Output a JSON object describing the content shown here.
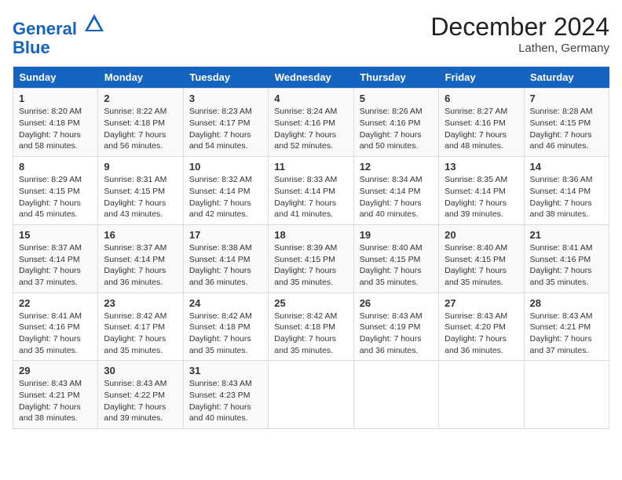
{
  "header": {
    "logo_line1": "General",
    "logo_line2": "Blue",
    "month": "December 2024",
    "location": "Lathen, Germany"
  },
  "weekdays": [
    "Sunday",
    "Monday",
    "Tuesday",
    "Wednesday",
    "Thursday",
    "Friday",
    "Saturday"
  ],
  "weeks": [
    [
      {
        "day": "1",
        "info": "Sunrise: 8:20 AM\nSunset: 4:18 PM\nDaylight: 7 hours\nand 58 minutes."
      },
      {
        "day": "2",
        "info": "Sunrise: 8:22 AM\nSunset: 4:18 PM\nDaylight: 7 hours\nand 56 minutes."
      },
      {
        "day": "3",
        "info": "Sunrise: 8:23 AM\nSunset: 4:17 PM\nDaylight: 7 hours\nand 54 minutes."
      },
      {
        "day": "4",
        "info": "Sunrise: 8:24 AM\nSunset: 4:16 PM\nDaylight: 7 hours\nand 52 minutes."
      },
      {
        "day": "5",
        "info": "Sunrise: 8:26 AM\nSunset: 4:16 PM\nDaylight: 7 hours\nand 50 minutes."
      },
      {
        "day": "6",
        "info": "Sunrise: 8:27 AM\nSunset: 4:16 PM\nDaylight: 7 hours\nand 48 minutes."
      },
      {
        "day": "7",
        "info": "Sunrise: 8:28 AM\nSunset: 4:15 PM\nDaylight: 7 hours\nand 46 minutes."
      }
    ],
    [
      {
        "day": "8",
        "info": "Sunrise: 8:29 AM\nSunset: 4:15 PM\nDaylight: 7 hours\nand 45 minutes."
      },
      {
        "day": "9",
        "info": "Sunrise: 8:31 AM\nSunset: 4:15 PM\nDaylight: 7 hours\nand 43 minutes."
      },
      {
        "day": "10",
        "info": "Sunrise: 8:32 AM\nSunset: 4:14 PM\nDaylight: 7 hours\nand 42 minutes."
      },
      {
        "day": "11",
        "info": "Sunrise: 8:33 AM\nSunset: 4:14 PM\nDaylight: 7 hours\nand 41 minutes."
      },
      {
        "day": "12",
        "info": "Sunrise: 8:34 AM\nSunset: 4:14 PM\nDaylight: 7 hours\nand 40 minutes."
      },
      {
        "day": "13",
        "info": "Sunrise: 8:35 AM\nSunset: 4:14 PM\nDaylight: 7 hours\nand 39 minutes."
      },
      {
        "day": "14",
        "info": "Sunrise: 8:36 AM\nSunset: 4:14 PM\nDaylight: 7 hours\nand 38 minutes."
      }
    ],
    [
      {
        "day": "15",
        "info": "Sunrise: 8:37 AM\nSunset: 4:14 PM\nDaylight: 7 hours\nand 37 minutes."
      },
      {
        "day": "16",
        "info": "Sunrise: 8:37 AM\nSunset: 4:14 PM\nDaylight: 7 hours\nand 36 minutes."
      },
      {
        "day": "17",
        "info": "Sunrise: 8:38 AM\nSunset: 4:14 PM\nDaylight: 7 hours\nand 36 minutes."
      },
      {
        "day": "18",
        "info": "Sunrise: 8:39 AM\nSunset: 4:15 PM\nDaylight: 7 hours\nand 35 minutes."
      },
      {
        "day": "19",
        "info": "Sunrise: 8:40 AM\nSunset: 4:15 PM\nDaylight: 7 hours\nand 35 minutes."
      },
      {
        "day": "20",
        "info": "Sunrise: 8:40 AM\nSunset: 4:15 PM\nDaylight: 7 hours\nand 35 minutes."
      },
      {
        "day": "21",
        "info": "Sunrise: 8:41 AM\nSunset: 4:16 PM\nDaylight: 7 hours\nand 35 minutes."
      }
    ],
    [
      {
        "day": "22",
        "info": "Sunrise: 8:41 AM\nSunset: 4:16 PM\nDaylight: 7 hours\nand 35 minutes."
      },
      {
        "day": "23",
        "info": "Sunrise: 8:42 AM\nSunset: 4:17 PM\nDaylight: 7 hours\nand 35 minutes."
      },
      {
        "day": "24",
        "info": "Sunrise: 8:42 AM\nSunset: 4:18 PM\nDaylight: 7 hours\nand 35 minutes."
      },
      {
        "day": "25",
        "info": "Sunrise: 8:42 AM\nSunset: 4:18 PM\nDaylight: 7 hours\nand 35 minutes."
      },
      {
        "day": "26",
        "info": "Sunrise: 8:43 AM\nSunset: 4:19 PM\nDaylight: 7 hours\nand 36 minutes."
      },
      {
        "day": "27",
        "info": "Sunrise: 8:43 AM\nSunset: 4:20 PM\nDaylight: 7 hours\nand 36 minutes."
      },
      {
        "day": "28",
        "info": "Sunrise: 8:43 AM\nSunset: 4:21 PM\nDaylight: 7 hours\nand 37 minutes."
      }
    ],
    [
      {
        "day": "29",
        "info": "Sunrise: 8:43 AM\nSunset: 4:21 PM\nDaylight: 7 hours\nand 38 minutes."
      },
      {
        "day": "30",
        "info": "Sunrise: 8:43 AM\nSunset: 4:22 PM\nDaylight: 7 hours\nand 39 minutes."
      },
      {
        "day": "31",
        "info": "Sunrise: 8:43 AM\nSunset: 4:23 PM\nDaylight: 7 hours\nand 40 minutes."
      },
      {
        "day": "",
        "info": ""
      },
      {
        "day": "",
        "info": ""
      },
      {
        "day": "",
        "info": ""
      },
      {
        "day": "",
        "info": ""
      }
    ]
  ]
}
